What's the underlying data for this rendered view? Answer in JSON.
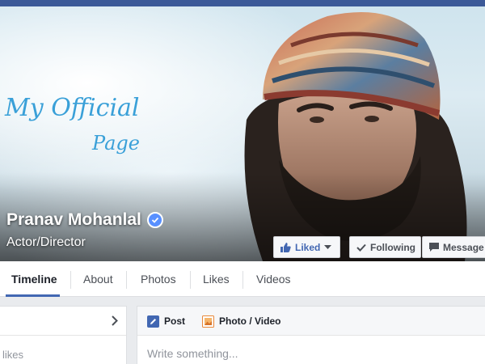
{
  "cover": {
    "tagline_line1": "My Official",
    "tagline_line2": "Page",
    "page_name": "Pranav Mohanlal",
    "category": "Actor/Director"
  },
  "buttons": {
    "liked": "Liked",
    "following": "Following",
    "message": "Message"
  },
  "nav": {
    "tabs": [
      "Timeline",
      "About",
      "Photos",
      "Likes",
      "Videos"
    ],
    "active": "Timeline"
  },
  "left_panel": {
    "text": "likes"
  },
  "composer": {
    "tab_post": "Post",
    "tab_photo_video": "Photo / Video",
    "placeholder": "Write something..."
  },
  "colors": {
    "brand_blue": "#3b5998",
    "link_blue": "#4267b2",
    "verified_blue": "#5890ff"
  }
}
